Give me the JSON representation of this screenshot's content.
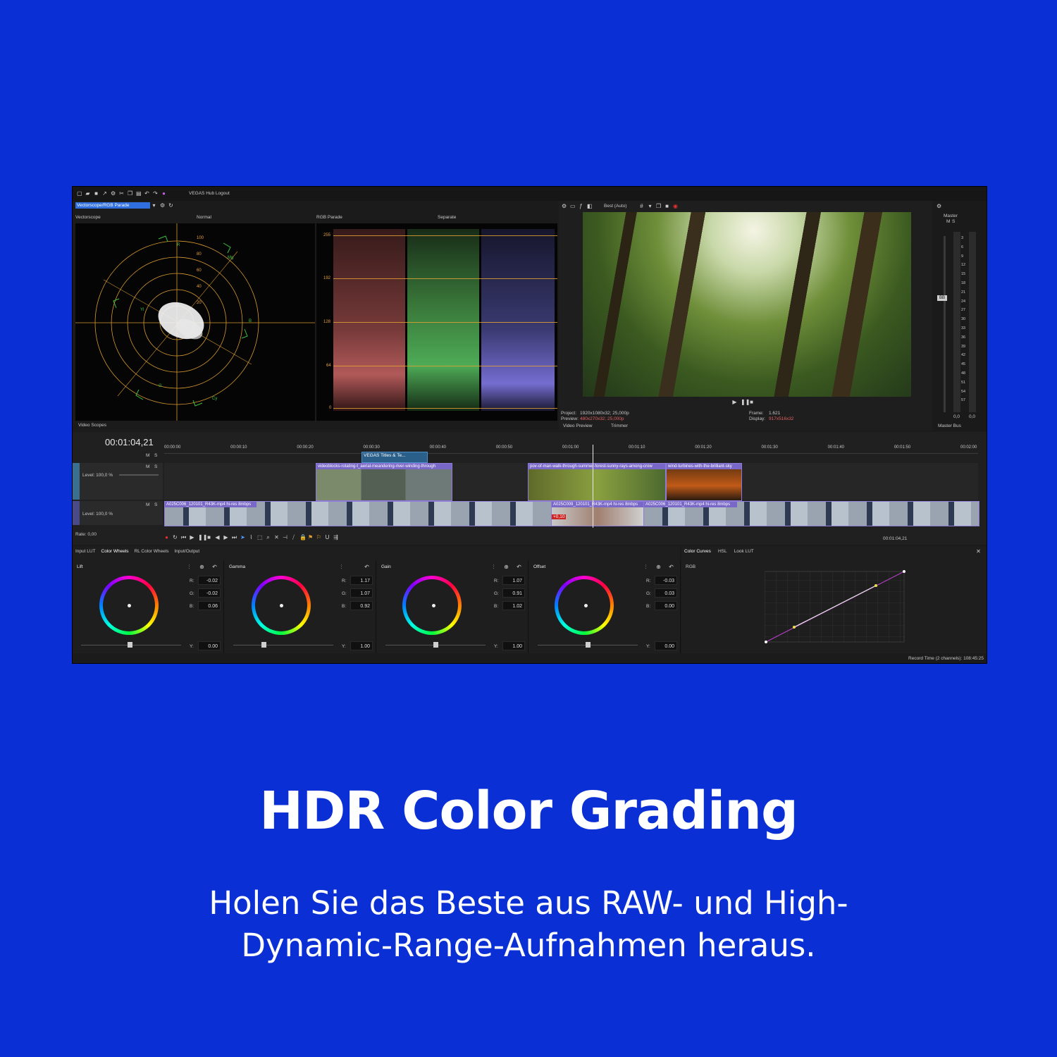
{
  "toolbar": {
    "hub_label": "VEGAS Hub Logout"
  },
  "scopes": {
    "selector": "Vectorscope/RGB Parade",
    "vectorscope_label": "Vectorscope",
    "vectorscope_mode": "Normal",
    "parade_label": "RGB Parade",
    "parade_mode": "Separate",
    "rings": [
      "100",
      "80",
      "60",
      "40",
      "20"
    ],
    "targets": [
      "R",
      "Mg",
      "B",
      "Cy",
      "G",
      "Yl"
    ],
    "parade_ticks": [
      "255",
      "192",
      "128",
      "64",
      "0"
    ],
    "tab": "Video Scopes"
  },
  "preview": {
    "quality": "Best (Auto)",
    "project_label": "Project:",
    "project_value": "1920x1080x32; 25,000p",
    "preview_label": "Preview:",
    "preview_value": "480x270x32; 25,000p",
    "frame_label": "Frame:",
    "frame_value": "1.621",
    "display_label": "Display:",
    "display_value": "917x516x32",
    "tab_preview": "Video Preview",
    "tab_trimmer": "Trimmer"
  },
  "master": {
    "label": "Master",
    "ms_m": "M",
    "ms_s": "S",
    "db_marks": [
      "3",
      "6",
      "9",
      "12",
      "15",
      "18",
      "21",
      "24",
      "27",
      "30",
      "33",
      "36",
      "39",
      "42",
      "45",
      "48",
      "51",
      "54",
      "57"
    ],
    "bottom_left": "0,0",
    "bottom_right": "0,0",
    "fader_label": "BB",
    "tab": "Master Bus"
  },
  "timeline": {
    "timecode": "00:01:04,21",
    "ruler": [
      "00:00:00",
      "00:00:10",
      "00:00:20",
      "00:00:30",
      "00:00:40",
      "00:00:50",
      "00:01:00",
      "00:01:10",
      "00:01:20",
      "00:01:30",
      "00:01:40",
      "00:01:50",
      "00:02:00"
    ],
    "track_m": "M",
    "track_s": "S",
    "track1_level": "Level: 100,0 %",
    "track2_level": "Level: 100,0 %",
    "rate": "Rate: 0,00",
    "titles_clip": "VEGAS Titles & Te...",
    "clip_a": "videoblocks-rotating-t_aerial-meandering-river-winding-through",
    "clip_b": "pov-of-man-walk-through-summer-forest-sunny-rays-among-crow",
    "clip_c": "wind-turbines-with-the-brilliant-sky",
    "clip_d": "A025C006_120101_R43K-mp4 hi-res 8mbps",
    "clip_e": "A025C009_120101_R43K-mp4 hi-res 8mbps",
    "clip_f": "A025C006_120101_R43K-mp4 hi-res 8mbps",
    "clip_marker": "+0,10",
    "cursor_time": "00:01:04,21"
  },
  "color": {
    "tabs": [
      "Input LUT",
      "Color Wheels",
      "RL Color Wheels",
      "Input/Output"
    ],
    "wheels": [
      {
        "name": "Lift",
        "r": "-0.02",
        "g": "-0.02",
        "b": "0.06",
        "y": "0.00"
      },
      {
        "name": "Gamma",
        "r": "1.17",
        "g": "1.07",
        "b": "0.92",
        "y": "1.00"
      },
      {
        "name": "Gain",
        "r": "1.07",
        "g": "0.91",
        "b": "1.02",
        "y": "1.00"
      },
      {
        "name": "Offset",
        "r": "-0.03",
        "g": "0.03",
        "b": "0.00",
        "y": "0.00"
      }
    ],
    "r_label": "R:",
    "g_label": "G:",
    "b_label": "B:",
    "y_label": "Y:",
    "curves_tabs": [
      "Color Curves",
      "HSL",
      "Look LUT"
    ],
    "curve_channel": "RGB",
    "record_time": "Record Time (2 channels): 108:45:25"
  },
  "marketing": {
    "headline": "HDR Color Grading",
    "line1": "Holen Sie das Beste aus RAW- und High-",
    "line2": "Dynamic-Range-Aufnahmen heraus."
  },
  "colors": {
    "background": "#0a2fd4",
    "scope_grid": "#e0a030",
    "clip": "#7a68c8"
  }
}
